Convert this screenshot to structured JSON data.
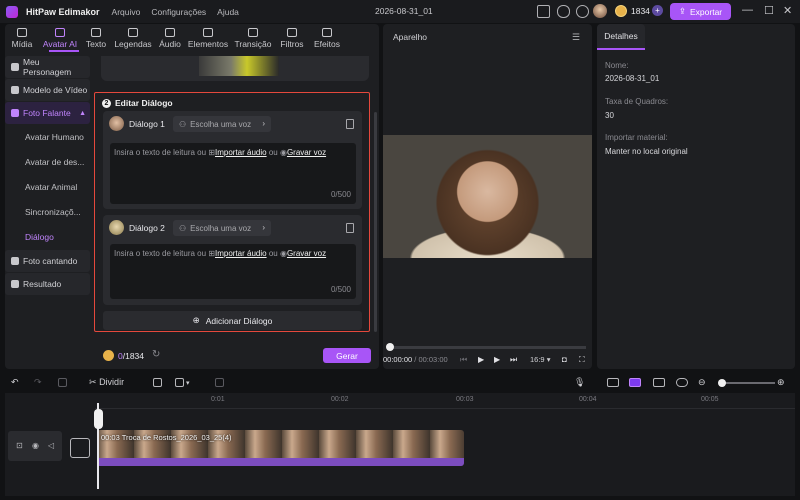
{
  "app": {
    "name": "HitPaw Edimakor",
    "doc_title": "2026-08-31_01",
    "coins": "1834",
    "export_label": "Exportar"
  },
  "menu": [
    "Arquivo",
    "Configurações",
    "Ajuda"
  ],
  "toptabs": [
    "Mídia",
    "Avatar AI",
    "Texto",
    "Legendas",
    "Áudio",
    "Elementos",
    "Transição",
    "Filtros",
    "Efeitos"
  ],
  "sidebar": {
    "items": [
      "Meu Personagem",
      "Modelo de Vídeo",
      "Foto Falante",
      "Avatar Humano",
      "Avatar de des...",
      "Avatar Animal",
      "Sincronizaçõ...",
      "Diálogo",
      "Foto cantando",
      "Resultado"
    ]
  },
  "dialog": {
    "section_number": "2",
    "title": "Editar Diálogo",
    "cards": [
      {
        "name": "Diálogo 1",
        "voice": "Escolha uma voz",
        "placeholder": "Insira o texto de leitura ou",
        "import": "Importar áudio",
        "or": "ou",
        "record": "Gravar voz",
        "count": "0/500"
      },
      {
        "name": "Diálogo 2",
        "voice": "Escolha uma voz",
        "placeholder": "Insira o texto de leitura ou",
        "import": "Importar áudio",
        "or": "ou",
        "record": "Gravar voz",
        "count": "0/500"
      }
    ],
    "add_label": "Adicionar Diálogo"
  },
  "bottom": {
    "used": "0",
    "total": "/1834",
    "generate": "Gerar"
  },
  "preview": {
    "title": "Aparelho",
    "current": "00:00:00",
    "total": "/ 00:03:00",
    "ratio": "16:9"
  },
  "details": {
    "tab": "Detalhes",
    "fields": [
      {
        "label": "Nome:",
        "value": "2026-08-31_01"
      },
      {
        "label": "Taxa de Quadros:",
        "value": "30"
      },
      {
        "label": "Importar material:",
        "value": "Manter no local original"
      }
    ]
  },
  "timeline": {
    "split_label": "Dividir",
    "ticks": [
      "0:01",
      "00:02",
      "00:03",
      "00:04",
      "00:05"
    ],
    "clip_label": "00:03  Troca de Rostos_2026_03_25(4)"
  }
}
